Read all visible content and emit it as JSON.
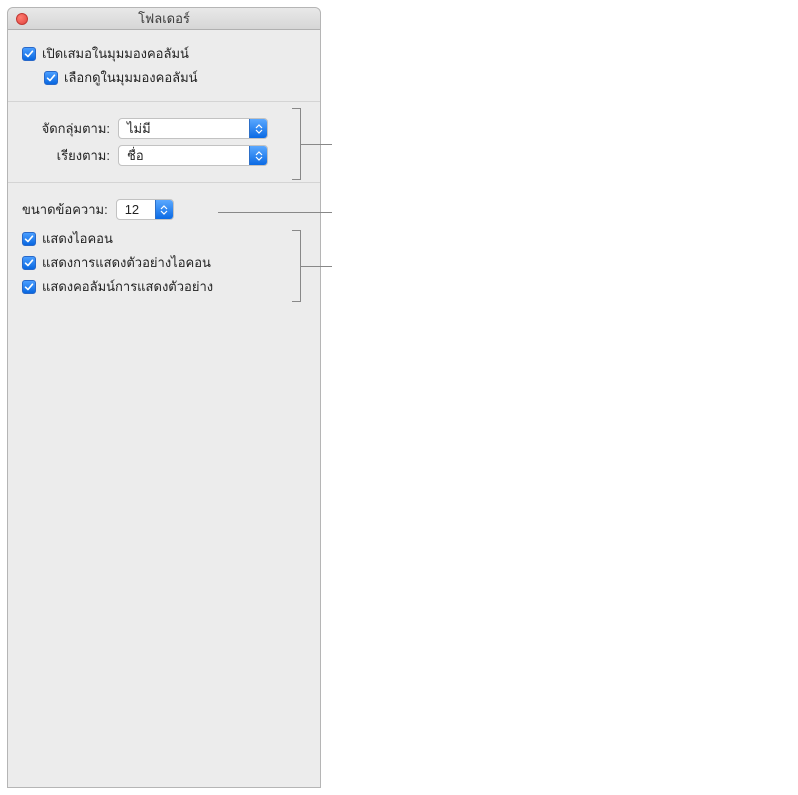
{
  "window": {
    "title": "โฟลเดอร์"
  },
  "section1": {
    "always_open_label": "เปิดเสมอในมุมมองคอลัมน์",
    "browse_label": "เลือกดูในมุมมองคอลัมน์"
  },
  "section2": {
    "group_by_label": "จัดกลุ่มตาม:",
    "group_by_value": "ไม่มี",
    "sort_by_label": "เรียงตาม:",
    "sort_by_value": "ชื่อ"
  },
  "section3": {
    "text_size_label": "ขนาดข้อความ:",
    "text_size_value": "12",
    "show_icons_label": "แสดงไอคอน",
    "show_icon_preview_label": "แสดงการแสดงตัวอย่างไอคอน",
    "show_preview_column_label": "แสดงคอลัมน์การแสดงตัวอย่าง"
  }
}
